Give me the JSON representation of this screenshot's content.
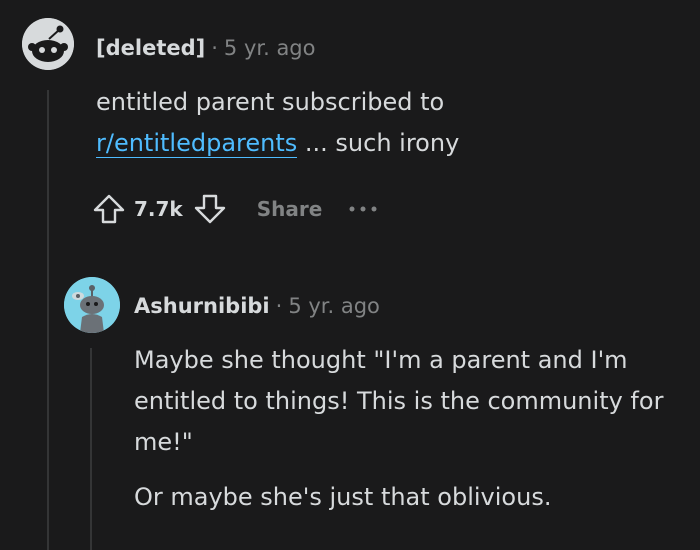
{
  "comment": {
    "author": "[deleted]",
    "separator": "·",
    "age": "5 yr. ago",
    "text_line1": "entitled parent subscribed to",
    "link": "r/entitledparents",
    "text_after_link": " ... such irony",
    "score": "7.7k",
    "share_label": "Share"
  },
  "reply": {
    "author": "Ashurnibibi",
    "separator": "·",
    "age": "5 yr. ago",
    "paragraph1": "Maybe she thought \"I'm a parent and I'm entitled to things! This is the community for me!\"",
    "paragraph2": "Or maybe she's just that oblivious."
  },
  "colors": {
    "background": "#1a1a1b",
    "link": "#4fbcff",
    "reply_avatar_bg": "#7dd3e8",
    "text": "#d7dadc",
    "muted": "#818384"
  },
  "icons": {
    "upvote": "arrow-up-outline",
    "downvote": "arrow-down-outline",
    "more": "three-dots-horizontal"
  }
}
